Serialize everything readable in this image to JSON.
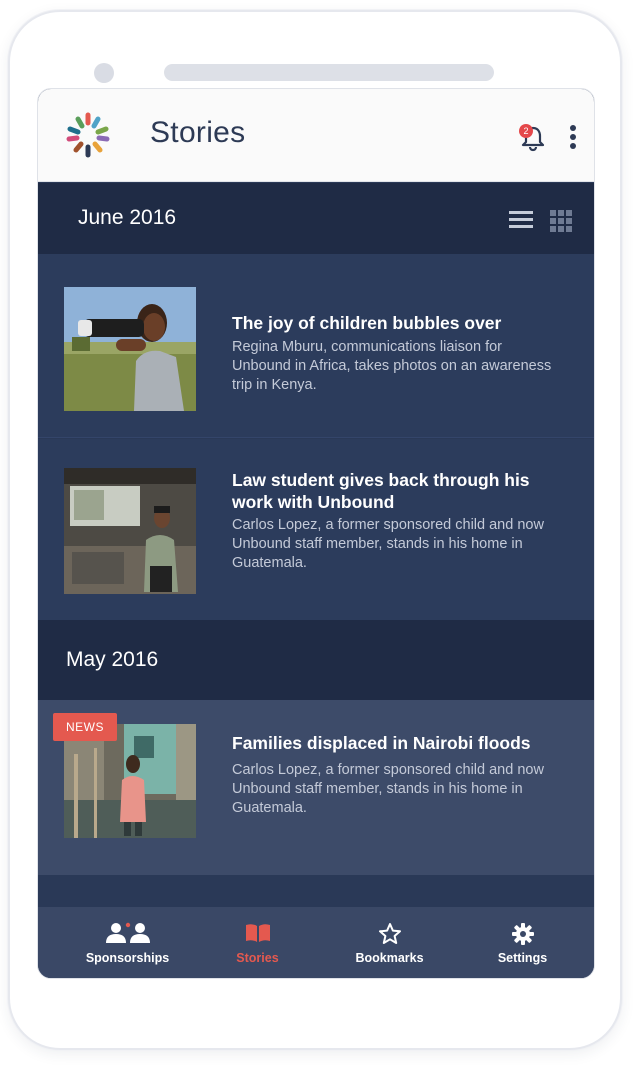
{
  "app": {
    "title": "Stories"
  },
  "header": {
    "notification_count": "2"
  },
  "sections": [
    {
      "month": "June 2016",
      "stories": [
        {
          "title": "The joy of children bubbles over",
          "description": "Regina Mburu, communications liaison for Unbound in Africa, takes photos on an awareness trip in Kenya."
        },
        {
          "title": "Law student gives back through his work with Unbound",
          "description": "Carlos Lopez, a former sponsored child and now Unbound staff member, stands in his home in Guatemala."
        }
      ]
    },
    {
      "month": "May 2016",
      "stories": [
        {
          "badge": "NEWS",
          "title": "Families displaced in Nairobi floods",
          "description": "Carlos Lopez, a former sponsored child and now Unbound staff member, stands in his home in Guatemala."
        }
      ]
    }
  ],
  "tabs": [
    {
      "label": "Sponsorships",
      "icon": "people-icon"
    },
    {
      "label": "Stories",
      "icon": "book-icon",
      "active": true
    },
    {
      "label": "Bookmarks",
      "icon": "star-icon"
    },
    {
      "label": "Settings",
      "icon": "gear-icon"
    }
  ],
  "colors": {
    "accent": "#e4594f",
    "appbar_bg": "#fafafa",
    "month_bar_bg": "#1f2b45",
    "story_bg": "#2c3c5c",
    "tabbar_bg": "#3a4866"
  }
}
